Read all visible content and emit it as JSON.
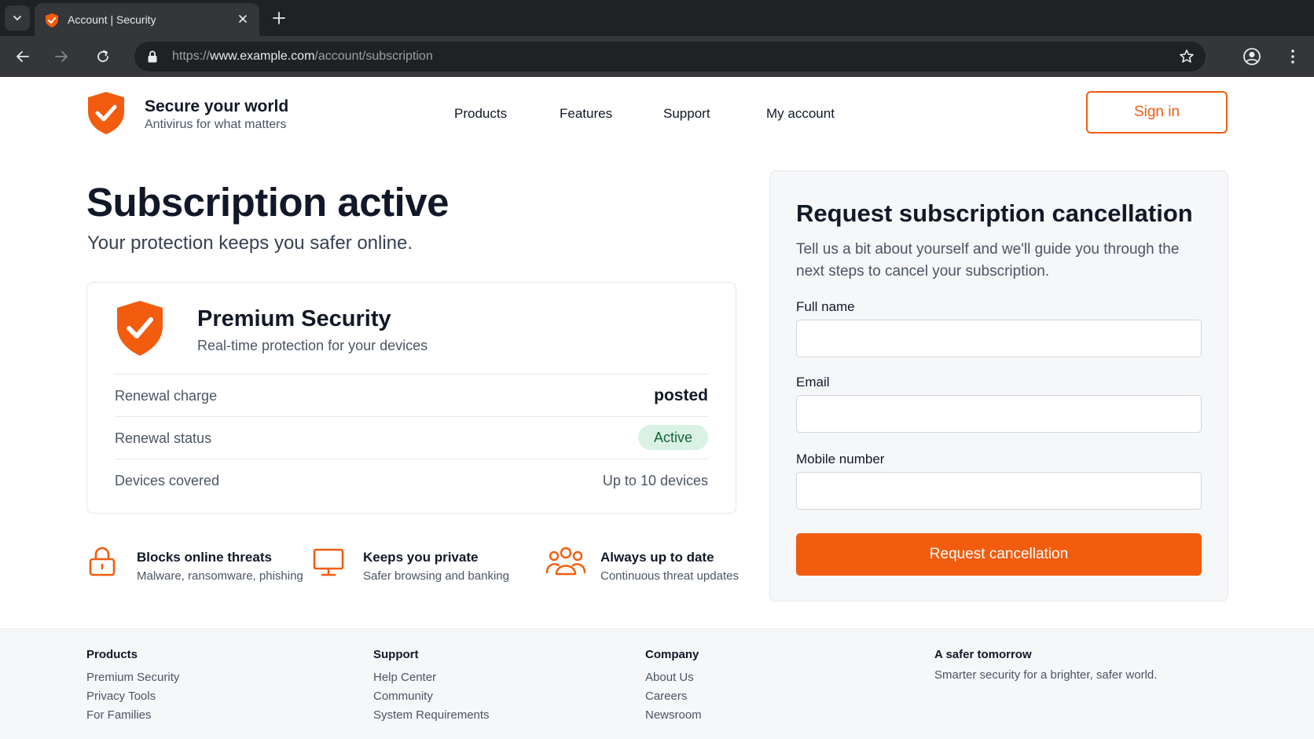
{
  "browser": {
    "tab_title": "Account | Security",
    "url_prefix": "https://",
    "url_host": "www.example.com",
    "url_path": "/account/subscription"
  },
  "header": {
    "brand_name": "Secure your world",
    "brand_tagline": "Antivirus for what matters",
    "nav": [
      "Products",
      "Features",
      "Support",
      "My account"
    ],
    "signin_label": "Sign in"
  },
  "hero": {
    "title": "Subscription active",
    "subtitle": "Your protection keeps you safer online."
  },
  "plan": {
    "name": "Premium Security",
    "description": "Real-time protection for your devices",
    "rows": [
      {
        "label": "Renewal charge",
        "value": "posted"
      },
      {
        "label": "Renewal status",
        "value": "Active"
      },
      {
        "label": "Devices covered",
        "value": "Up to 10 devices"
      }
    ]
  },
  "features": [
    {
      "title": "Blocks online threats",
      "subtitle": "Malware, ransomware, phishing",
      "icon": "lock-icon"
    },
    {
      "title": "Keeps you private",
      "subtitle": "Safer browsing and banking",
      "icon": "monitor-icon"
    },
    {
      "title": "Always up to date",
      "subtitle": "Continuous threat updates",
      "icon": "users-icon"
    }
  ],
  "form": {
    "title": "Request subscription cancellation",
    "intro": "Tell us a bit about yourself and we'll guide you through the next steps to cancel your subscription.",
    "fields": [
      {
        "label": "Full name",
        "value": ""
      },
      {
        "label": "Email",
        "value": ""
      },
      {
        "label": "Mobile number",
        "value": ""
      }
    ],
    "submit_label": "Request cancellation"
  },
  "footer": {
    "columns": [
      {
        "heading": "Products",
        "links": [
          "Premium Security",
          "Privacy Tools",
          "For Families"
        ]
      },
      {
        "heading": "Support",
        "links": [
          "Help Center",
          "Community",
          "System Requirements"
        ]
      },
      {
        "heading": "Company",
        "links": [
          "About Us",
          "Careers",
          "Newsroom"
        ]
      }
    ],
    "about_heading": "A safer tomorrow",
    "about_text": "Smarter security for a brighter, safer world."
  },
  "colors": {
    "accent": "#f25c0f",
    "badge_bg": "#d9f2e4",
    "badge_text": "#166534"
  }
}
